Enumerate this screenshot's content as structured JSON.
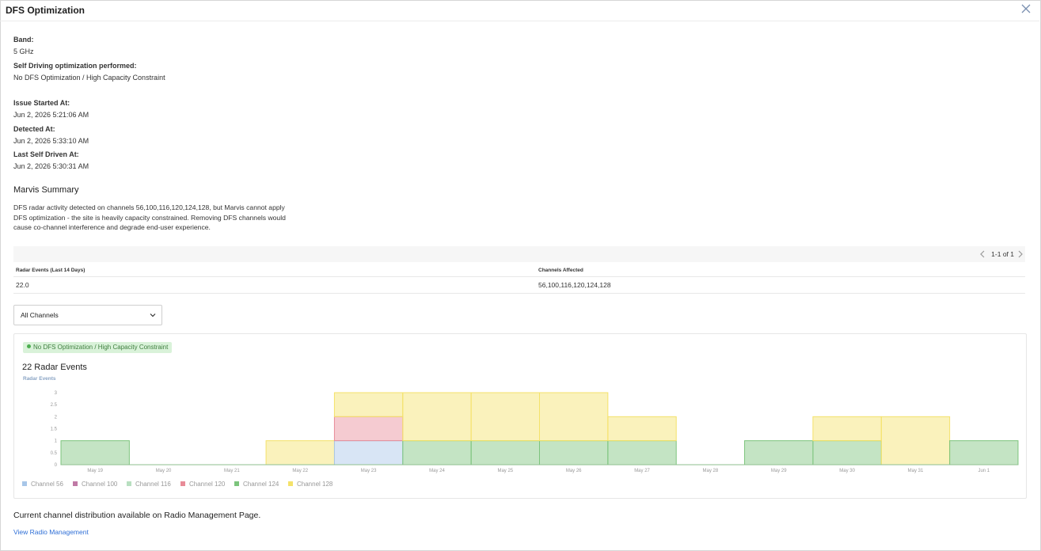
{
  "window": {
    "title": "DFS Optimization"
  },
  "details": {
    "band_label": "Band:",
    "band_value": "5 GHz",
    "optimization_label": "Self Driving optimization performed:",
    "optimization_value": "No DFS Optimization / High Capacity Constraint",
    "issue_started_label": "Issue Started At:",
    "issue_started_value": "Jun 2, 2026 5:21:06 AM",
    "detected_label": "Detected At:",
    "detected_value": "Jun 2, 2026 5:33:10 AM",
    "last_driven_label": "Last Self Driven At:",
    "last_driven_value": "Jun 2, 2026 5:30:31 AM"
  },
  "summary": {
    "title": "Marvis Summary",
    "text": "DFS radar activity detected on channels 56,100,116,120,124,128, but Marvis cannot apply DFS optimization - the site is heavily capacity constrained. Removing DFS channels would cause co-channel interference and degrade end-user experience."
  },
  "pagination": {
    "text": "1-1 of 1"
  },
  "table": {
    "headers": [
      "Radar Events (Last 14 Days)",
      "Channels Affected"
    ],
    "rows": [
      [
        "22.0",
        "56,100,116,120,124,128"
      ]
    ]
  },
  "filter": {
    "selected": "All Channels"
  },
  "chart_card": {
    "badge": "No DFS Optimization / High Capacity Constraint",
    "title": "22 Radar Events"
  },
  "chart_data": {
    "type": "bar",
    "stacked": true,
    "ylabel": "Radar Events",
    "ylim": [
      0,
      3
    ],
    "yticks": [
      "0",
      "0.5",
      "1",
      "1.5",
      "2",
      "2.5",
      "3"
    ],
    "categories": [
      "May 19",
      "May 20",
      "May 21",
      "May 22",
      "May 23",
      "May 24",
      "May 25",
      "May 26",
      "May 27",
      "May 28",
      "May 29",
      "May 30",
      "May 31",
      "Jun 1"
    ],
    "series": [
      {
        "name": "Channel 56",
        "color": "#a8c6e8",
        "values": [
          0,
          0,
          0,
          0,
          1,
          0,
          0,
          0,
          0,
          0,
          0,
          0,
          0,
          0
        ]
      },
      {
        "name": "Channel 100",
        "color": "#c07aa6",
        "values": [
          0,
          0,
          0,
          0,
          0,
          0,
          0,
          0,
          0,
          0,
          0,
          0,
          0,
          0
        ]
      },
      {
        "name": "Channel 116",
        "color": "#b8dfc0",
        "values": [
          0,
          0,
          0,
          0,
          0,
          0,
          0,
          0,
          0,
          0,
          0,
          0,
          0,
          0
        ]
      },
      {
        "name": "Channel 120",
        "color": "#e88c98",
        "values": [
          0,
          0,
          0,
          0,
          1,
          0,
          0,
          0,
          0,
          0,
          0,
          0,
          0,
          0
        ]
      },
      {
        "name": "Channel 124",
        "color": "#7cc47c",
        "values": [
          1,
          0,
          0,
          0,
          0,
          1,
          1,
          1,
          1,
          0,
          1,
          1,
          0,
          1
        ]
      },
      {
        "name": "Channel 128",
        "color": "#f4e26a",
        "values": [
          0,
          0,
          0,
          1,
          1,
          2,
          2,
          2,
          1,
          0,
          0,
          1,
          2,
          0
        ]
      }
    ],
    "legend_position": "bottom-left",
    "grid": false
  },
  "footer": {
    "text": "Current channel distribution available on Radio Management Page.",
    "link": "View Radio Management"
  }
}
